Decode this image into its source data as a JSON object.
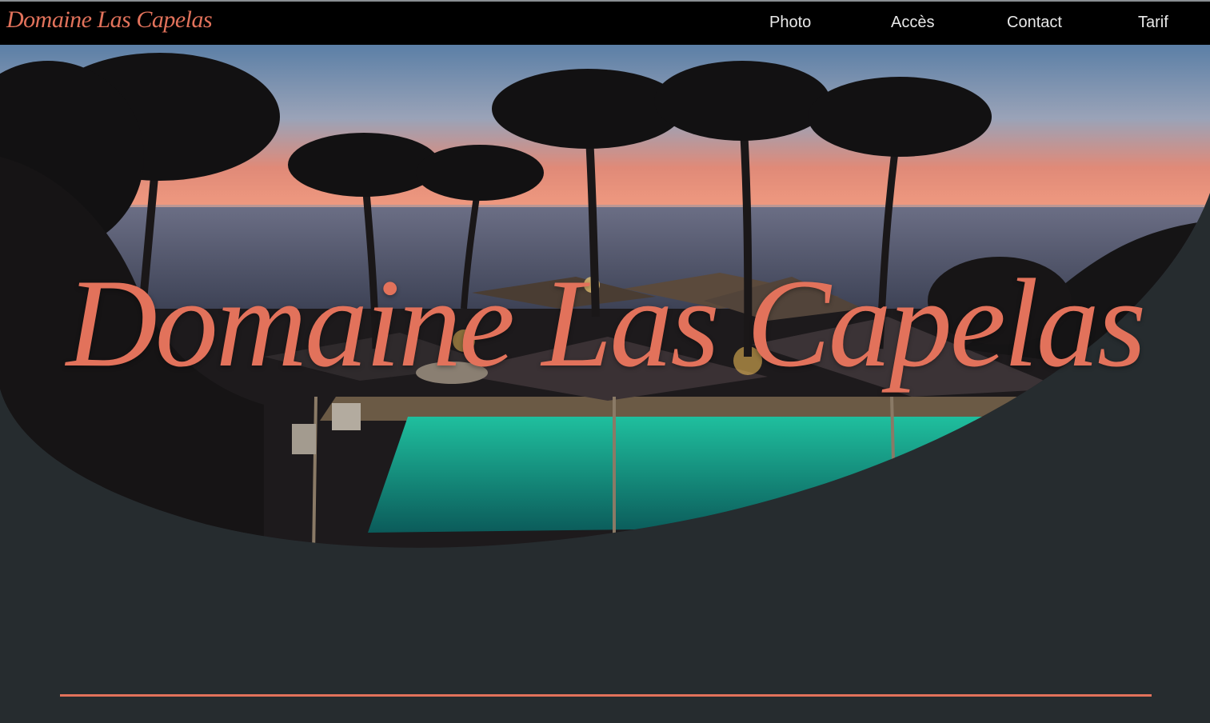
{
  "site": {
    "logo_text": "Domaine Las Capelas",
    "hero_title": "Domaine Las Capelas"
  },
  "nav": {
    "items": [
      {
        "label": "Photo"
      },
      {
        "label": "Accès"
      },
      {
        "label": "Contact"
      },
      {
        "label": "Tarif"
      }
    ]
  },
  "colors": {
    "accent": "#e2725b",
    "page_background": "#262c2f",
    "header_background": "#000000",
    "nav_text": "#e9e9e9"
  }
}
